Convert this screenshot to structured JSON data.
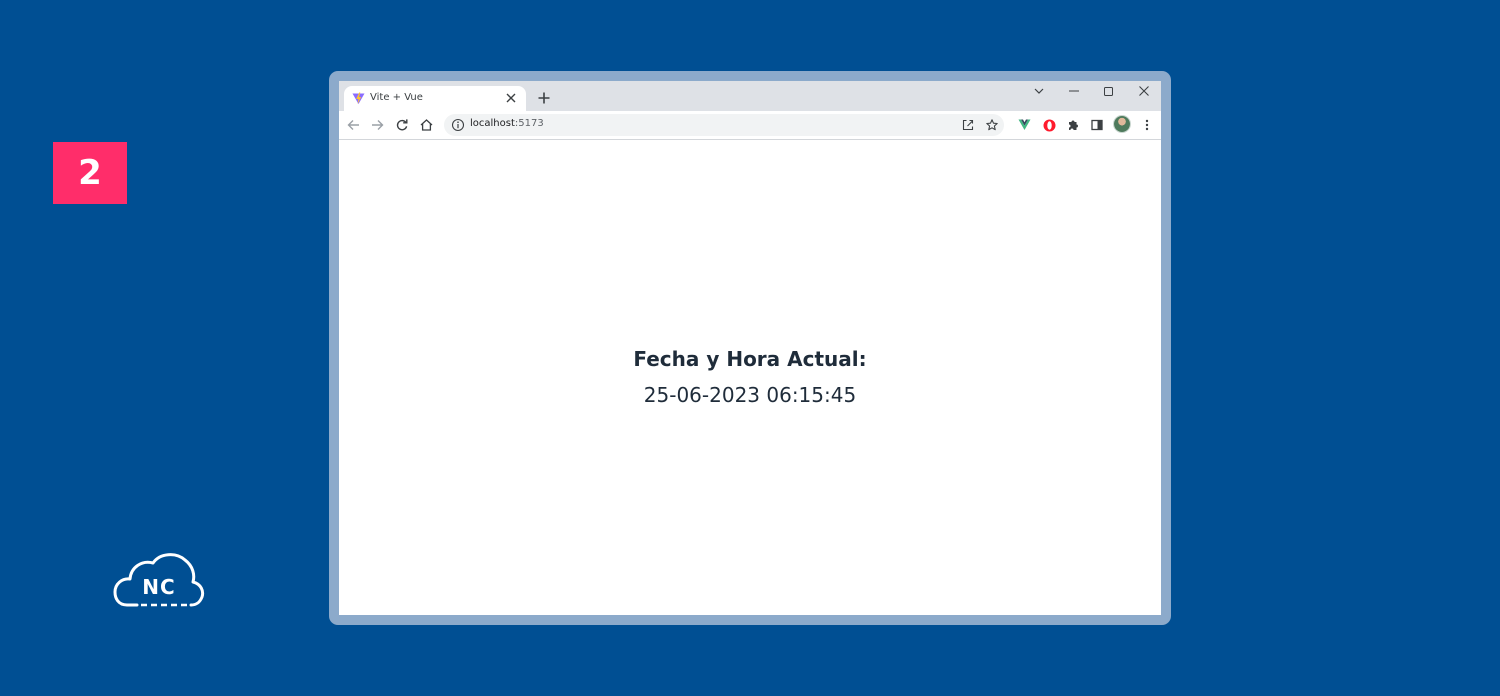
{
  "step_badge": "2",
  "logo": {
    "text": "NC"
  },
  "browser": {
    "tab": {
      "title": "Vite + Vue",
      "favicon": "vite-logo-icon"
    },
    "address_bar": {
      "host": "localhost",
      "port": ":5173"
    },
    "toolbar_icons": [
      "back-icon",
      "forward-icon",
      "reload-icon",
      "home-icon",
      "info-icon",
      "share-icon",
      "star-icon",
      "vue-devtools-icon",
      "opera-icon",
      "extensions-icon",
      "side-panel-icon",
      "profile-avatar",
      "menu-icon"
    ],
    "window_controls": [
      "tab-search-icon",
      "minimize-icon",
      "maximize-icon",
      "close-icon"
    ]
  },
  "page": {
    "heading": "Fecha y Hora Actual:",
    "datetime": "25-06-2023 06:15:45"
  },
  "colors": {
    "background": "#004f93",
    "badge": "#ff2d6a",
    "frame": "#8caacb",
    "text": "#1f2c3a"
  }
}
